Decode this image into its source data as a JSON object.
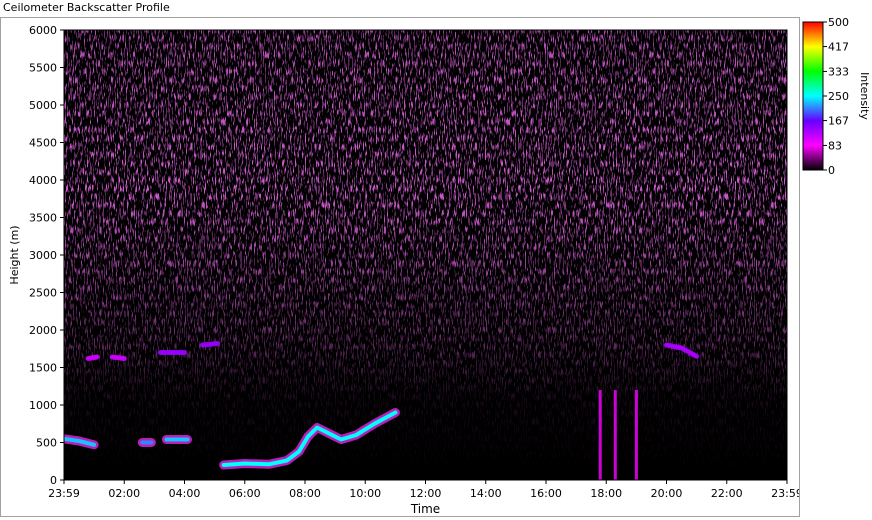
{
  "window": {
    "title": "Ceilometer Backscatter Profile"
  },
  "chart_data": {
    "type": "heatmap",
    "title": "Ceilometer Backscatter Profile",
    "xlabel": "Time",
    "ylabel": "Height (m)",
    "x_ticks": [
      "23:59",
      "02:00",
      "04:00",
      "06:00",
      "08:00",
      "10:00",
      "12:00",
      "14:00",
      "16:00",
      "18:00",
      "20:00",
      "22:00",
      "23:59"
    ],
    "x_range": [
      "23:59",
      "23:59"
    ],
    "y_ticks": [
      0,
      500,
      1000,
      1500,
      2000,
      2500,
      3000,
      3500,
      4000,
      4500,
      5000,
      5500,
      6000
    ],
    "ylim": [
      0,
      6000
    ],
    "colorbar": {
      "label": "Intensity",
      "ticks": [
        500,
        417,
        333,
        250,
        167,
        83,
        0
      ],
      "range": [
        0,
        500
      ],
      "colors": [
        "#000000",
        "#ff00ff",
        "#6600ff",
        "#00ffff",
        "#00ff00",
        "#ffff00",
        "#ff0000"
      ]
    },
    "grid": false,
    "background_color": "#000000",
    "noise_color": "#cc22cc",
    "features": [
      {
        "name": "low cloud layer",
        "points": [
          [
            0.0,
            550
          ],
          [
            0.5,
            520
          ],
          [
            1.0,
            470
          ]
        ],
        "intensity": 230
      },
      {
        "name": "low cloud layer",
        "points": [
          [
            2.6,
            500
          ],
          [
            2.9,
            500
          ]
        ],
        "intensity": 210
      },
      {
        "name": "low cloud layer",
        "points": [
          [
            3.4,
            540
          ],
          [
            4.1,
            540
          ]
        ],
        "intensity": 230
      },
      {
        "name": "low cloud layer",
        "points": [
          [
            5.3,
            200
          ],
          [
            6.0,
            220
          ],
          [
            6.8,
            210
          ],
          [
            7.4,
            260
          ],
          [
            7.8,
            380
          ],
          [
            8.1,
            580
          ],
          [
            8.4,
            700
          ],
          [
            8.8,
            620
          ],
          [
            9.2,
            540
          ],
          [
            9.7,
            600
          ],
          [
            10.3,
            750
          ],
          [
            11.0,
            900
          ]
        ],
        "intensity": 250
      },
      {
        "name": "elevated layer",
        "points": [
          [
            0.8,
            1620
          ],
          [
            1.1,
            1640
          ]
        ],
        "intensity": 110
      },
      {
        "name": "elevated layer",
        "points": [
          [
            1.6,
            1640
          ],
          [
            2.0,
            1620
          ]
        ],
        "intensity": 110
      },
      {
        "name": "elevated layer",
        "points": [
          [
            3.2,
            1700
          ],
          [
            4.0,
            1700
          ]
        ],
        "intensity": 140
      },
      {
        "name": "elevated layer",
        "points": [
          [
            4.6,
            1800
          ],
          [
            5.1,
            1820
          ]
        ],
        "intensity": 140
      },
      {
        "name": "elevated layer",
        "points": [
          [
            20.0,
            1800
          ],
          [
            20.5,
            1760
          ],
          [
            21.0,
            1650
          ]
        ],
        "intensity": 130
      },
      {
        "name": "precipitation streak",
        "points": [
          [
            17.8,
            1200
          ],
          [
            17.8,
            0
          ],
          [
            18.3,
            1200
          ],
          [
            18.3,
            0
          ],
          [
            19.0,
            1200
          ],
          [
            19.0,
            0
          ]
        ],
        "intensity": 90
      }
    ]
  }
}
